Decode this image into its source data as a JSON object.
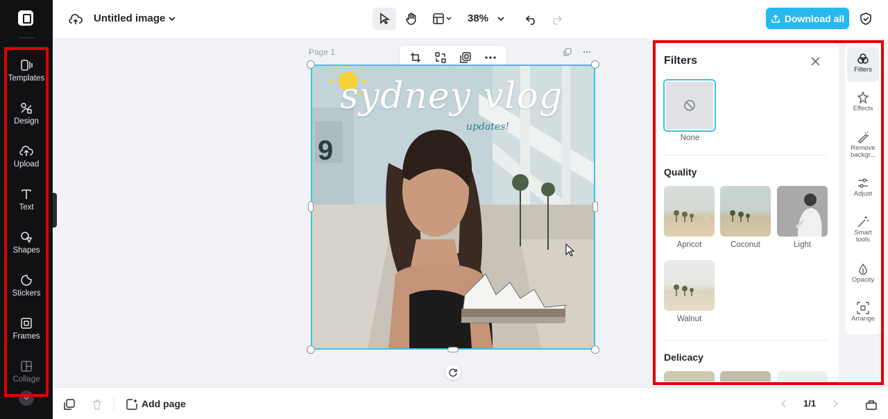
{
  "app": {
    "doc_title": "Untitled image",
    "zoom": "38%",
    "download_label": "Download all",
    "page_label": "Page 1",
    "add_page_label": "Add page",
    "pager": "1/1"
  },
  "left_tools": [
    {
      "label": "Templates",
      "icon": "templates-icon"
    },
    {
      "label": "Design",
      "icon": "design-icon"
    },
    {
      "label": "Upload",
      "icon": "upload-icon"
    },
    {
      "label": "Text",
      "icon": "text-icon"
    },
    {
      "label": "Shapes",
      "icon": "shapes-icon"
    },
    {
      "label": "Stickers",
      "icon": "stickers-icon"
    },
    {
      "label": "Frames",
      "icon": "frames-icon"
    },
    {
      "label": "Collage",
      "icon": "collage-icon"
    }
  ],
  "filters": {
    "title": "Filters",
    "none_label": "None",
    "quality_title": "Quality",
    "quality_items": [
      "Apricot",
      "Coconut",
      "Light",
      "Walnut"
    ],
    "delicacy_title": "Delicacy"
  },
  "rail": [
    {
      "label": "Filters",
      "icon": "filters-icon"
    },
    {
      "label": "Effects",
      "icon": "effects-icon"
    },
    {
      "label": "Remove backgr...",
      "icon": "remove-background-icon"
    },
    {
      "label": "Adjust",
      "icon": "adjust-icon"
    },
    {
      "label": "Smart tools",
      "icon": "smart-tools-icon"
    },
    {
      "label": "Opacity",
      "icon": "opacity-icon"
    },
    {
      "label": "Arrange",
      "icon": "arrange-icon"
    }
  ],
  "canvas_text": {
    "headline": "sydney vlog",
    "subline": "updates!"
  },
  "colors": {
    "accent": "#28b8f0",
    "selection": "#36c5e8",
    "highlight_box": "#e00000",
    "sidebar_bg": "#101113"
  }
}
